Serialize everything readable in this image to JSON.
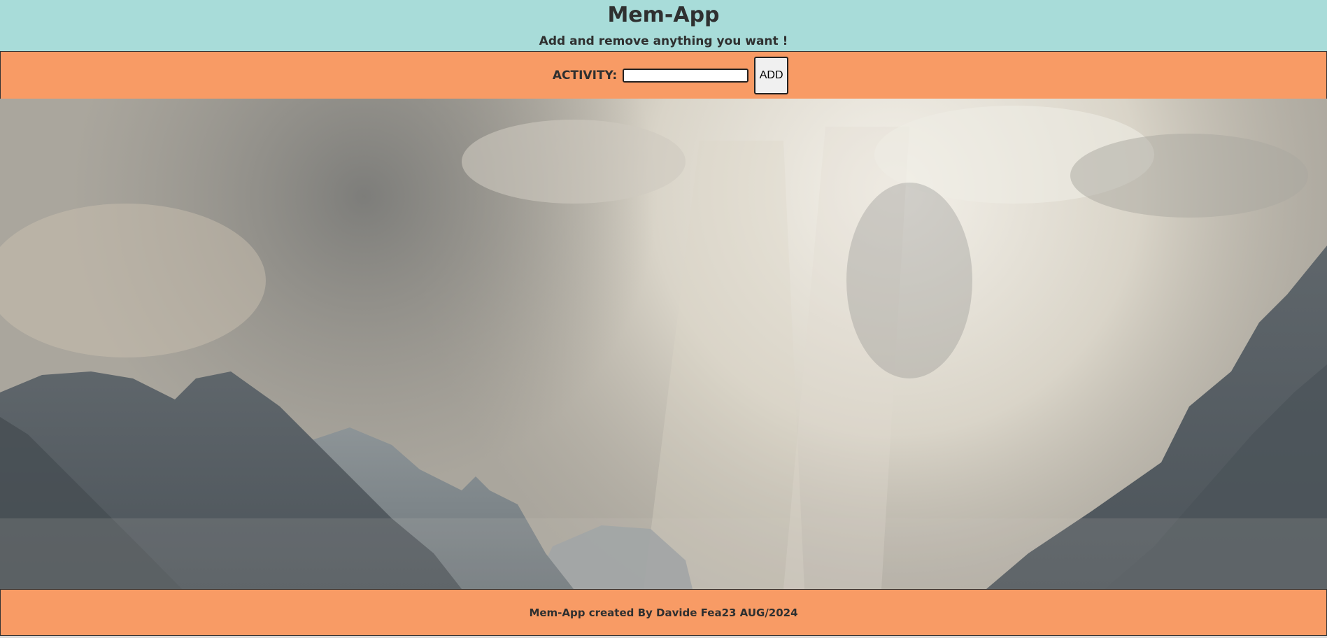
{
  "header": {
    "title": "Mem-App",
    "subtitle": "Add and remove anything you want !"
  },
  "form": {
    "activity_label": "ACTIVITY:",
    "activity_value": "",
    "add_label": "ADD"
  },
  "footer": {
    "credit": "Mem-App created By Davide Fea23 AUG/2024"
  },
  "colors": {
    "header_bg": "#a8dcd9",
    "bar_bg": "#f89b65",
    "text": "#2f3030"
  }
}
